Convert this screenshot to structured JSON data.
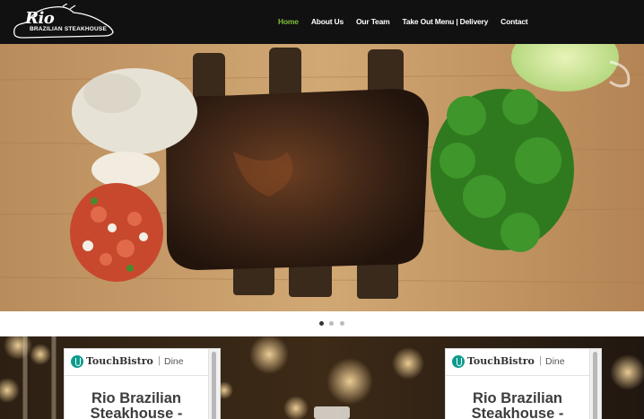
{
  "brand": {
    "logo_main": "Rio",
    "logo_sub": "BRAZILIAN STEAKHOUSE"
  },
  "nav": {
    "items": [
      {
        "label": "Home",
        "active": true
      },
      {
        "label": "About Us",
        "active": false
      },
      {
        "label": "Our Team",
        "active": false
      },
      {
        "label": "Take Out Menu | Delivery",
        "active": false
      },
      {
        "label": "Contact",
        "active": false
      }
    ]
  },
  "slider": {
    "slide_count": 3,
    "active_index": 0
  },
  "widgets": [
    {
      "brand": "TouchBistro",
      "separator": "|",
      "product": "Dine",
      "title": "Rio Brazilian Steakhouse -"
    },
    {
      "brand": "TouchBistro",
      "separator": "|",
      "product": "Dine",
      "title": "Rio Brazilian Steakhouse -"
    }
  ],
  "colors": {
    "nav_bg": "#111111",
    "nav_active": "#7fbf3a",
    "touchbistro_teal": "#0f9b8e"
  }
}
